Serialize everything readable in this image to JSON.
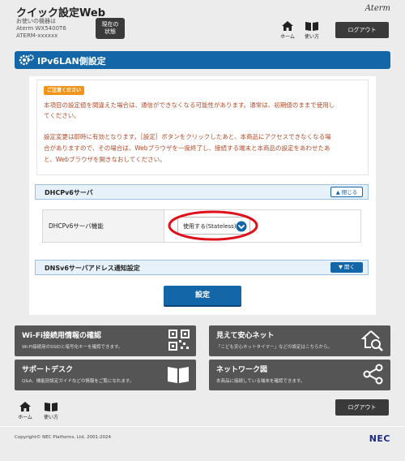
{
  "header": {
    "app_title": "クイック設定Web",
    "device_caption": "お使いの機器は",
    "device_model": "Aterm WX5400T6",
    "device_serial": "ATERM-xxxxxx",
    "status_button": "現在の\n状態",
    "brand": "Aterm",
    "nav_home": "ホーム",
    "nav_help": "使い方",
    "logout": "ログアウト"
  },
  "page": {
    "title": "IPv6LAN側設定"
  },
  "warning": {
    "badge": "ご注意ください",
    "line1": "本項目の設定値を間違えた場合は、通信ができなくなる可能性があります。通常は、初期値のままで使用し",
    "line2": "てください。",
    "line3": "設定変更は即時に有効となります。［設定］ボタンをクリックしたあと、本商品にアクセスできなくなる場",
    "line4": "合がありますので、その場合は、Webブラウザを一度終了し、接続する端末と本商品の設定をあわせたあ",
    "line5": "と、Webブラウザを開きなおしてください。"
  },
  "dhcp_section": {
    "title": "DHCPv6サーバ",
    "toggle": "閉じる",
    "setting_label": "DHCPv6サーバ機能",
    "selected_value": "使用する(Stateless)"
  },
  "dns_section": {
    "title": "DNSv6サーバアドレス通知設定",
    "toggle": "開く"
  },
  "actions": {
    "apply": "設定"
  },
  "tiles": [
    {
      "title": "Wi-Fi接続用情報の確認",
      "desc": "Wi-Fi接続用のSSIDと暗号化キーを確認できます。",
      "icon": "qr-code-icon"
    },
    {
      "title": "見えて安心ネット",
      "desc": "「こども安心ネットタイマー」などの設定はこちらから。",
      "icon": "house-search-icon"
    },
    {
      "title": "サポートデスク",
      "desc": "Q&A、機能別設定ガイドなどの情報をご覧になれます。",
      "icon": "book-icon"
    },
    {
      "title": "ネットワーク図",
      "desc": "本商品に接続している端末を確認できます。",
      "icon": "network-icon"
    }
  ],
  "footer": {
    "copyright": "Copyright© NEC Platforms, Ltd. 2001-2024",
    "logo": "NEC"
  },
  "colors": {
    "primary_blue": "#1366a8",
    "warning_text": "#b24a2a",
    "caution_badge": "#f0941a",
    "highlight_red": "#e0101a",
    "tile_bg": "#555555"
  }
}
